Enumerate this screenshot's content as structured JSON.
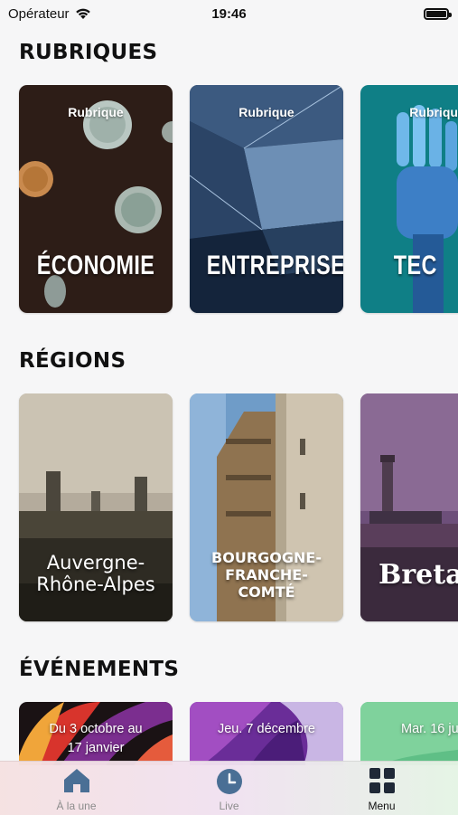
{
  "status_bar": {
    "carrier": "Opérateur",
    "time": "19:46"
  },
  "sections": {
    "rubriques": {
      "title": "RUBRIQUES",
      "cards": [
        {
          "kicker": "Rubrique",
          "label": "ÉCONOMIE"
        },
        {
          "kicker": "Rubrique",
          "label": "ENTREPRISES"
        },
        {
          "kicker": "Rubrique",
          "label": "TEC"
        }
      ]
    },
    "regions": {
      "title": "RÉGIONS",
      "cards": [
        {
          "line1": "Auvergne-",
          "line2": "Rhône-Alpes"
        },
        {
          "line1": "BOURGOGNE-",
          "line2": "FRANCHE-",
          "line3": "COMTÉ"
        },
        {
          "label": "Bretag"
        }
      ]
    },
    "evenements": {
      "title": "ÉVÉNEMENTS",
      "cards": [
        {
          "line1": "Du 3 octobre au",
          "line2": "17 janvier"
        },
        {
          "line1": "Jeu. 7 décembre"
        },
        {
          "line1": "Mar. 16 ju"
        }
      ]
    }
  },
  "tab_bar": {
    "tabs": [
      {
        "label": "À la une",
        "icon": "home-icon"
      },
      {
        "label": "Live",
        "icon": "clock-icon"
      },
      {
        "label": "Menu",
        "icon": "grid-icon"
      }
    ],
    "active_color": "#1f2937",
    "inactive_color": "#4a6f95"
  }
}
